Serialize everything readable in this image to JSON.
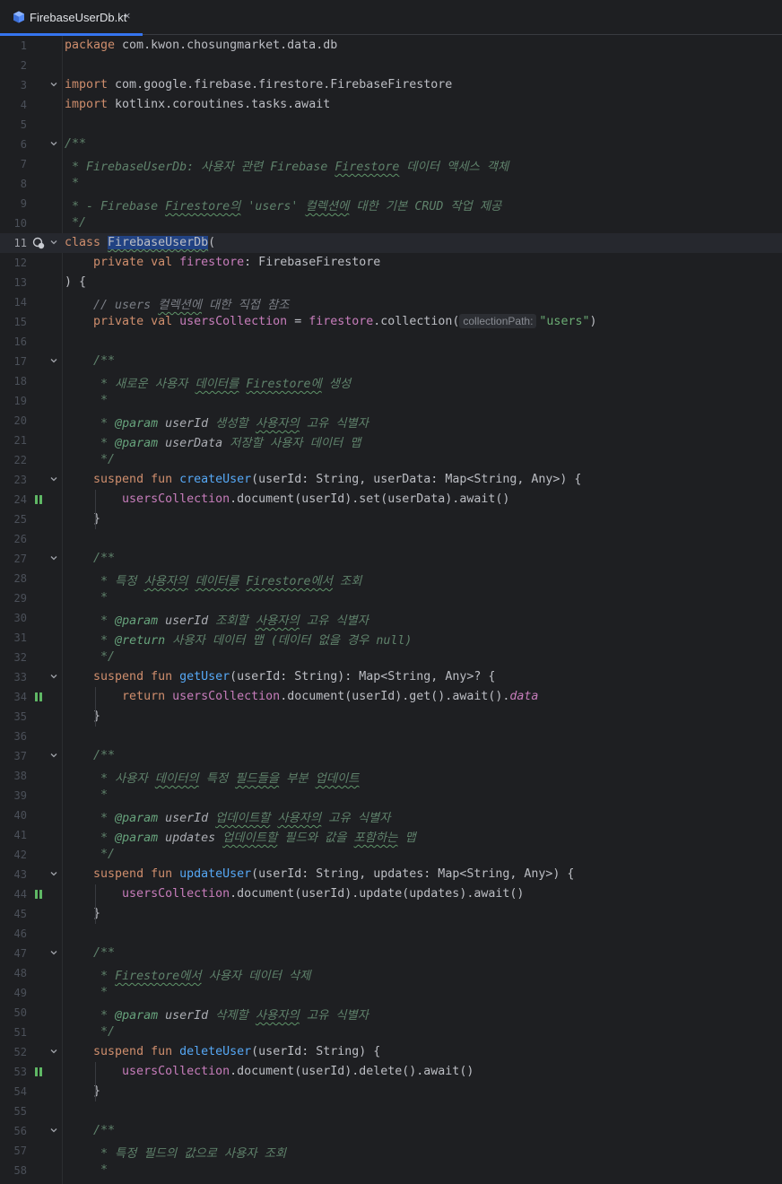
{
  "tab": {
    "title": "FirebaseUserDb.kt",
    "close": "×"
  },
  "lines": [
    {
      "n": "1",
      "parts": [
        [
          "kw",
          "package "
        ],
        [
          "",
          "com.kwon.chosungmarket.data.db"
        ]
      ]
    },
    {
      "n": "2",
      "parts": []
    },
    {
      "n": "3",
      "fold": true,
      "parts": [
        [
          "kw",
          "import "
        ],
        [
          "",
          "com.google.firebase.firestore.FirebaseFirestore"
        ]
      ]
    },
    {
      "n": "4",
      "parts": [
        [
          "kw",
          "import "
        ],
        [
          "",
          "kotlinx.coroutines.tasks.await"
        ]
      ]
    },
    {
      "n": "5",
      "parts": []
    },
    {
      "n": "6",
      "fold": true,
      "parts": [
        [
          "dc",
          "/**"
        ]
      ]
    },
    {
      "n": "7",
      "parts": [
        [
          "dc",
          " * FirebaseUserDb: 사용자 관련 Firebase "
        ],
        [
          "dc typo",
          "Firestore"
        ],
        [
          "dc",
          " 데이터 액세스 객체"
        ]
      ]
    },
    {
      "n": "8",
      "parts": [
        [
          "dc",
          " *"
        ]
      ]
    },
    {
      "n": "9",
      "parts": [
        [
          "dc",
          " * - Firebase "
        ],
        [
          "dc typo",
          "Firestore의"
        ],
        [
          "dc",
          " 'users' "
        ],
        [
          "dc typo",
          "컬렉션에"
        ],
        [
          "dc",
          " 대한 기본 CRUD 작업 제공"
        ]
      ]
    },
    {
      "n": "10",
      "parts": [
        [
          "dc",
          " */"
        ]
      ]
    },
    {
      "n": "11",
      "fold": true,
      "current": true,
      "icon": "class-usage-icon",
      "parts": [
        [
          "kw",
          "class "
        ],
        [
          "sel typo",
          "FirebaseUserDb"
        ],
        [
          "",
          "("
        ]
      ]
    },
    {
      "n": "12",
      "parts": [
        [
          "",
          "    "
        ],
        [
          "kw",
          "private val "
        ],
        [
          "prop",
          "firestore"
        ],
        [
          "",
          ": FirebaseFirestore"
        ]
      ]
    },
    {
      "n": "13",
      "parts": [
        [
          "",
          ") {"
        ]
      ]
    },
    {
      "n": "14",
      "parts": [
        [
          "",
          "    "
        ],
        [
          "cm",
          "// users "
        ],
        [
          "cm typo",
          "컬렉션에"
        ],
        [
          "cm",
          " 대한 직접 참조"
        ]
      ]
    },
    {
      "n": "15",
      "parts": [
        [
          "",
          "    "
        ],
        [
          "kw",
          "private val "
        ],
        [
          "prop",
          "usersCollection"
        ],
        [
          "",
          " = "
        ],
        [
          "prop",
          "firestore"
        ],
        [
          "",
          ".collection("
        ],
        [
          "hint",
          "collectionPath:"
        ],
        [
          "str",
          "\"users\""
        ],
        [
          "",
          ")"
        ]
      ]
    },
    {
      "n": "16",
      "parts": []
    },
    {
      "n": "17",
      "fold": true,
      "parts": [
        [
          "",
          "    "
        ],
        [
          "dc",
          "/**"
        ]
      ]
    },
    {
      "n": "18",
      "parts": [
        [
          "",
          "    "
        ],
        [
          "dc",
          " * 새로운 사용자 "
        ],
        [
          "dc typo",
          "데이터를"
        ],
        [
          "dc",
          " "
        ],
        [
          "dc typo",
          "Firestore에"
        ],
        [
          "dc",
          " 생성"
        ]
      ]
    },
    {
      "n": "19",
      "parts": [
        [
          "",
          "    "
        ],
        [
          "dc",
          " *"
        ]
      ]
    },
    {
      "n": "20",
      "parts": [
        [
          "",
          "    "
        ],
        [
          "dc",
          " * "
        ],
        [
          "dtag",
          "@param"
        ],
        [
          "dparam",
          " userId"
        ],
        [
          "dc",
          " 생성할 "
        ],
        [
          "dc typo",
          "사용자의"
        ],
        [
          "dc",
          " 고유 식별자"
        ]
      ]
    },
    {
      "n": "21",
      "parts": [
        [
          "",
          "    "
        ],
        [
          "dc",
          " * "
        ],
        [
          "dtag",
          "@param"
        ],
        [
          "dparam",
          " userData"
        ],
        [
          "dc",
          " 저장할 사용자 데이터 맵"
        ]
      ]
    },
    {
      "n": "22",
      "parts": [
        [
          "",
          "    "
        ],
        [
          "dc",
          " */"
        ]
      ]
    },
    {
      "n": "23",
      "fold": true,
      "parts": [
        [
          "",
          "    "
        ],
        [
          "kw",
          "suspend fun "
        ],
        [
          "fn",
          "createUser"
        ],
        [
          "",
          "(userId: String, userData: Map<String, Any>) {"
        ]
      ]
    },
    {
      "n": "24",
      "icon": "suspend-call-icon",
      "parts": [
        [
          "",
          "        "
        ],
        [
          "prop",
          "usersCollection"
        ],
        [
          "",
          ".document(userId).set(userData).await()"
        ]
      ]
    },
    {
      "n": "25",
      "parts": [
        [
          "",
          "    }"
        ]
      ]
    },
    {
      "n": "26",
      "parts": []
    },
    {
      "n": "27",
      "fold": true,
      "parts": [
        [
          "",
          "    "
        ],
        [
          "dc",
          "/**"
        ]
      ]
    },
    {
      "n": "28",
      "parts": [
        [
          "",
          "    "
        ],
        [
          "dc",
          " * 특정 "
        ],
        [
          "dc typo",
          "사용자의"
        ],
        [
          "dc",
          " "
        ],
        [
          "dc typo",
          "데이터를"
        ],
        [
          "dc",
          " "
        ],
        [
          "dc typo",
          "Firestore에서"
        ],
        [
          "dc",
          " 조회"
        ]
      ]
    },
    {
      "n": "29",
      "parts": [
        [
          "",
          "    "
        ],
        [
          "dc",
          " *"
        ]
      ]
    },
    {
      "n": "30",
      "parts": [
        [
          "",
          "    "
        ],
        [
          "dc",
          " * "
        ],
        [
          "dtag",
          "@param"
        ],
        [
          "dparam",
          " userId"
        ],
        [
          "dc",
          " 조회할 "
        ],
        [
          "dc typo",
          "사용자의"
        ],
        [
          "dc",
          " 고유 식별자"
        ]
      ]
    },
    {
      "n": "31",
      "parts": [
        [
          "",
          "    "
        ],
        [
          "dc",
          " * "
        ],
        [
          "dtag",
          "@return"
        ],
        [
          "dc",
          " 사용자 데이터 맵 (데이터 없을 경우 null)"
        ]
      ]
    },
    {
      "n": "32",
      "parts": [
        [
          "",
          "    "
        ],
        [
          "dc",
          " */"
        ]
      ]
    },
    {
      "n": "33",
      "fold": true,
      "parts": [
        [
          "",
          "    "
        ],
        [
          "kw",
          "suspend fun "
        ],
        [
          "fn",
          "getUser"
        ],
        [
          "",
          "(userId: String): Map<String, Any>? {"
        ]
      ]
    },
    {
      "n": "34",
      "icon": "suspend-call-icon",
      "parts": [
        [
          "",
          "        "
        ],
        [
          "kw",
          "return "
        ],
        [
          "prop",
          "usersCollection"
        ],
        [
          "",
          ".document(userId).get().await()."
        ],
        [
          "ext",
          "data"
        ]
      ]
    },
    {
      "n": "35",
      "parts": [
        [
          "",
          "    }"
        ]
      ]
    },
    {
      "n": "36",
      "parts": []
    },
    {
      "n": "37",
      "fold": true,
      "parts": [
        [
          "",
          "    "
        ],
        [
          "dc",
          "/**"
        ]
      ]
    },
    {
      "n": "38",
      "parts": [
        [
          "",
          "    "
        ],
        [
          "dc",
          " * 사용자 "
        ],
        [
          "dc typo",
          "데이터의"
        ],
        [
          "dc",
          " 특정 "
        ],
        [
          "dc typo",
          "필드들을"
        ],
        [
          "dc",
          " 부분 "
        ],
        [
          "dc typo",
          "업데이트"
        ]
      ]
    },
    {
      "n": "39",
      "parts": [
        [
          "",
          "    "
        ],
        [
          "dc",
          " *"
        ]
      ]
    },
    {
      "n": "40",
      "parts": [
        [
          "",
          "    "
        ],
        [
          "dc",
          " * "
        ],
        [
          "dtag",
          "@param"
        ],
        [
          "dparam",
          " userId"
        ],
        [
          "dc",
          " "
        ],
        [
          "dc typo",
          "업데이트할"
        ],
        [
          "dc",
          " "
        ],
        [
          "dc typo",
          "사용자의"
        ],
        [
          "dc",
          " 고유 식별자"
        ]
      ]
    },
    {
      "n": "41",
      "parts": [
        [
          "",
          "    "
        ],
        [
          "dc",
          " * "
        ],
        [
          "dtag",
          "@param"
        ],
        [
          "dparam",
          " updates"
        ],
        [
          "dc",
          " "
        ],
        [
          "dc typo",
          "업데이트할"
        ],
        [
          "dc",
          " 필드와 값을 "
        ],
        [
          "dc typo",
          "포함하는"
        ],
        [
          "dc",
          " 맵"
        ]
      ]
    },
    {
      "n": "42",
      "parts": [
        [
          "",
          "    "
        ],
        [
          "dc",
          " */"
        ]
      ]
    },
    {
      "n": "43",
      "fold": true,
      "parts": [
        [
          "",
          "    "
        ],
        [
          "kw",
          "suspend fun "
        ],
        [
          "fn",
          "updateUser"
        ],
        [
          "",
          "(userId: String, updates: Map<String, Any>) {"
        ]
      ]
    },
    {
      "n": "44",
      "icon": "suspend-call-icon",
      "parts": [
        [
          "",
          "        "
        ],
        [
          "prop",
          "usersCollection"
        ],
        [
          "",
          ".document(userId).update(updates).await()"
        ]
      ]
    },
    {
      "n": "45",
      "parts": [
        [
          "",
          "    }"
        ]
      ]
    },
    {
      "n": "46",
      "parts": []
    },
    {
      "n": "47",
      "fold": true,
      "parts": [
        [
          "",
          "    "
        ],
        [
          "dc",
          "/**"
        ]
      ]
    },
    {
      "n": "48",
      "parts": [
        [
          "",
          "    "
        ],
        [
          "dc",
          " * "
        ],
        [
          "dc typo",
          "Firestore에서"
        ],
        [
          "dc",
          " 사용자 데이터 삭제"
        ]
      ]
    },
    {
      "n": "49",
      "parts": [
        [
          "",
          "    "
        ],
        [
          "dc",
          " *"
        ]
      ]
    },
    {
      "n": "50",
      "parts": [
        [
          "",
          "    "
        ],
        [
          "dc",
          " * "
        ],
        [
          "dtag",
          "@param"
        ],
        [
          "dparam",
          " userId"
        ],
        [
          "dc",
          " 삭제할 "
        ],
        [
          "dc typo",
          "사용자의"
        ],
        [
          "dc",
          " 고유 식별자"
        ]
      ]
    },
    {
      "n": "51",
      "parts": [
        [
          "",
          "    "
        ],
        [
          "dc",
          " */"
        ]
      ]
    },
    {
      "n": "52",
      "fold": true,
      "parts": [
        [
          "",
          "    "
        ],
        [
          "kw",
          "suspend fun "
        ],
        [
          "fn",
          "deleteUser"
        ],
        [
          "",
          "(userId: String) {"
        ]
      ]
    },
    {
      "n": "53",
      "icon": "suspend-call-icon",
      "parts": [
        [
          "",
          "        "
        ],
        [
          "prop",
          "usersCollection"
        ],
        [
          "",
          ".document(userId).delete().await()"
        ]
      ]
    },
    {
      "n": "54",
      "parts": [
        [
          "",
          "    }"
        ]
      ]
    },
    {
      "n": "55",
      "parts": []
    },
    {
      "n": "56",
      "fold": true,
      "parts": [
        [
          "",
          "    "
        ],
        [
          "dc",
          "/**"
        ]
      ]
    },
    {
      "n": "57",
      "parts": [
        [
          "",
          "    "
        ],
        [
          "dc",
          " * 특정 필드의 값으로 사용자 조회"
        ]
      ]
    },
    {
      "n": "58",
      "parts": [
        [
          "",
          "    "
        ],
        [
          "dc",
          " *"
        ]
      ]
    }
  ]
}
